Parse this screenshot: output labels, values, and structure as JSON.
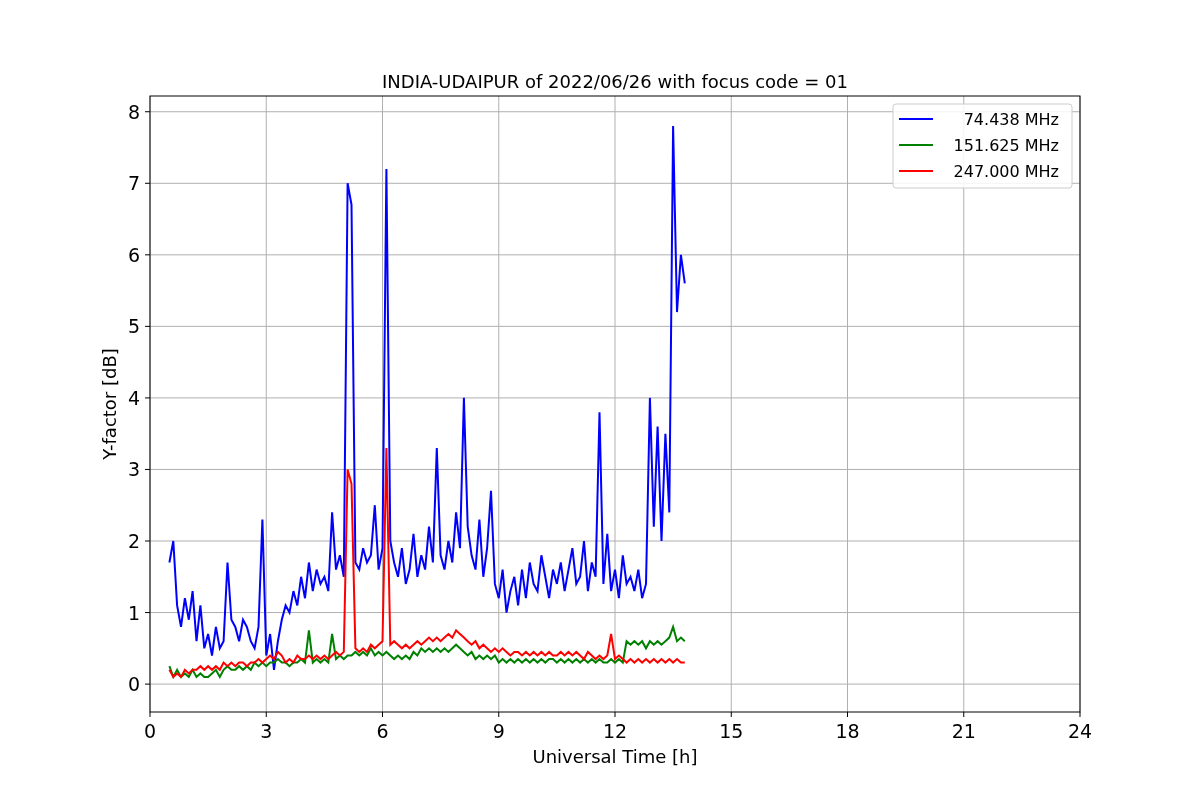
{
  "figure": {
    "chart_data": {
      "type": "line",
      "title": "INDIA-UDAIPUR of 2022/06/26 with focus code = 01",
      "xlabel": "Universal Time [h]",
      "ylabel": "Y-factor [dB]",
      "grid": true,
      "legend": true,
      "xlim": [
        0,
        24
      ],
      "ylim": [
        -0.39,
        8.22
      ],
      "xticks": [
        0,
        3,
        6,
        9,
        12,
        15,
        18,
        21,
        24
      ],
      "yticks": [
        0,
        1,
        2,
        3,
        4,
        5,
        6,
        7,
        8
      ],
      "x": [
        0.5,
        0.6,
        0.7,
        0.8,
        0.9,
        1.0,
        1.1,
        1.2,
        1.3,
        1.4,
        1.5,
        1.6,
        1.7,
        1.8,
        1.9,
        2.0,
        2.1,
        2.2,
        2.3,
        2.4,
        2.5,
        2.6,
        2.7,
        2.8,
        2.9,
        3.0,
        3.1,
        3.2,
        3.3,
        3.4,
        3.5,
        3.6,
        3.7,
        3.8,
        3.9,
        4.0,
        4.1,
        4.2,
        4.3,
        4.4,
        4.5,
        4.6,
        4.7,
        4.8,
        4.9,
        5.0,
        5.1,
        5.2,
        5.3,
        5.4,
        5.5,
        5.6,
        5.7,
        5.8,
        5.9,
        6.0,
        6.1,
        6.2,
        6.3,
        6.4,
        6.5,
        6.6,
        6.7,
        6.8,
        6.9,
        7.0,
        7.1,
        7.2,
        7.3,
        7.4,
        7.5,
        7.6,
        7.7,
        7.8,
        7.9,
        8.0,
        8.1,
        8.2,
        8.3,
        8.4,
        8.5,
        8.6,
        8.7,
        8.8,
        8.9,
        9.0,
        9.1,
        9.2,
        9.3,
        9.4,
        9.5,
        9.6,
        9.7,
        9.8,
        9.9,
        10.0,
        10.1,
        10.2,
        10.3,
        10.4,
        10.5,
        10.6,
        10.7,
        10.8,
        10.9,
        11.0,
        11.1,
        11.2,
        11.3,
        11.4,
        11.5,
        11.6,
        11.7,
        11.8,
        11.9,
        12.0,
        12.1,
        12.2,
        12.3,
        12.4,
        12.5,
        12.6,
        12.7,
        12.8,
        12.9,
        13.0,
        13.1,
        13.2,
        13.3,
        13.4,
        13.5,
        13.6,
        13.7,
        13.8
      ],
      "series": [
        {
          "name": "74.438 MHz",
          "color": "#0000ff",
          "values": [
            1.7,
            2.0,
            1.1,
            0.8,
            1.2,
            0.9,
            1.3,
            0.6,
            1.1,
            0.5,
            0.7,
            0.4,
            0.8,
            0.5,
            0.6,
            1.7,
            0.9,
            0.8,
            0.6,
            0.9,
            0.8,
            0.6,
            0.5,
            0.8,
            2.3,
            0.4,
            0.7,
            0.2,
            0.6,
            0.9,
            1.1,
            1.0,
            1.3,
            1.1,
            1.5,
            1.2,
            1.7,
            1.3,
            1.6,
            1.4,
            1.5,
            1.3,
            2.4,
            1.6,
            1.8,
            1.5,
            7.0,
            6.7,
            1.7,
            1.6,
            1.9,
            1.7,
            1.8,
            2.5,
            1.6,
            1.9,
            7.2,
            2.0,
            1.7,
            1.5,
            1.9,
            1.4,
            1.6,
            2.1,
            1.5,
            1.8,
            1.6,
            2.2,
            1.7,
            3.3,
            1.8,
            1.6,
            2.0,
            1.7,
            2.4,
            1.9,
            4.0,
            2.2,
            1.8,
            1.6,
            2.3,
            1.5,
            1.9,
            2.7,
            1.4,
            1.2,
            1.6,
            1.0,
            1.3,
            1.5,
            1.1,
            1.6,
            1.2,
            1.7,
            1.4,
            1.3,
            1.8,
            1.5,
            1.2,
            1.6,
            1.4,
            1.7,
            1.3,
            1.6,
            1.9,
            1.4,
            1.5,
            2.0,
            1.3,
            1.7,
            1.5,
            3.8,
            1.4,
            2.1,
            1.3,
            1.6,
            1.2,
            1.8,
            1.4,
            1.5,
            1.3,
            1.6,
            1.2,
            1.4,
            4.0,
            2.2,
            3.6,
            2.0,
            3.5,
            2.4,
            7.8,
            5.2,
            6.0,
            5.6
          ]
        },
        {
          "name": "151.625 MHz",
          "color": "#008000",
          "values": [
            0.25,
            0.1,
            0.2,
            0.1,
            0.15,
            0.1,
            0.2,
            0.1,
            0.15,
            0.1,
            0.1,
            0.15,
            0.2,
            0.1,
            0.2,
            0.25,
            0.2,
            0.2,
            0.25,
            0.2,
            0.25,
            0.2,
            0.3,
            0.25,
            0.3,
            0.25,
            0.3,
            0.3,
            0.35,
            0.3,
            0.3,
            0.25,
            0.3,
            0.3,
            0.35,
            0.3,
            0.75,
            0.3,
            0.35,
            0.3,
            0.35,
            0.3,
            0.7,
            0.35,
            0.4,
            0.35,
            0.4,
            0.4,
            0.45,
            0.4,
            0.45,
            0.4,
            0.5,
            0.4,
            0.45,
            0.4,
            0.45,
            0.4,
            0.35,
            0.4,
            0.35,
            0.4,
            0.35,
            0.45,
            0.4,
            0.5,
            0.45,
            0.5,
            0.45,
            0.5,
            0.45,
            0.5,
            0.45,
            0.5,
            0.55,
            0.5,
            0.45,
            0.4,
            0.45,
            0.35,
            0.4,
            0.35,
            0.4,
            0.35,
            0.4,
            0.3,
            0.35,
            0.3,
            0.35,
            0.3,
            0.35,
            0.3,
            0.35,
            0.3,
            0.35,
            0.3,
            0.35,
            0.3,
            0.35,
            0.35,
            0.3,
            0.35,
            0.3,
            0.35,
            0.3,
            0.35,
            0.3,
            0.35,
            0.3,
            0.35,
            0.3,
            0.35,
            0.3,
            0.3,
            0.35,
            0.3,
            0.35,
            0.3,
            0.6,
            0.55,
            0.6,
            0.55,
            0.6,
            0.5,
            0.6,
            0.55,
            0.6,
            0.55,
            0.6,
            0.65,
            0.8,
            0.6,
            0.65,
            0.6
          ]
        },
        {
          "name": "247.000 MHz",
          "color": "#ff0000",
          "values": [
            0.2,
            0.1,
            0.15,
            0.1,
            0.2,
            0.15,
            0.2,
            0.2,
            0.25,
            0.2,
            0.25,
            0.2,
            0.25,
            0.2,
            0.3,
            0.25,
            0.3,
            0.25,
            0.3,
            0.3,
            0.25,
            0.3,
            0.3,
            0.35,
            0.3,
            0.35,
            0.4,
            0.35,
            0.45,
            0.4,
            0.3,
            0.35,
            0.3,
            0.4,
            0.35,
            0.35,
            0.4,
            0.35,
            0.4,
            0.35,
            0.4,
            0.35,
            0.4,
            0.45,
            0.4,
            0.45,
            3.0,
            2.8,
            0.5,
            0.45,
            0.5,
            0.45,
            0.55,
            0.5,
            0.55,
            0.6,
            3.3,
            0.55,
            0.6,
            0.55,
            0.5,
            0.55,
            0.5,
            0.55,
            0.6,
            0.55,
            0.6,
            0.65,
            0.6,
            0.65,
            0.6,
            0.65,
            0.7,
            0.65,
            0.75,
            0.7,
            0.65,
            0.6,
            0.55,
            0.6,
            0.5,
            0.55,
            0.5,
            0.45,
            0.5,
            0.45,
            0.5,
            0.45,
            0.4,
            0.45,
            0.45,
            0.4,
            0.45,
            0.4,
            0.45,
            0.4,
            0.45,
            0.4,
            0.45,
            0.4,
            0.4,
            0.45,
            0.4,
            0.45,
            0.4,
            0.45,
            0.4,
            0.35,
            0.45,
            0.4,
            0.35,
            0.4,
            0.35,
            0.4,
            0.7,
            0.35,
            0.4,
            0.35,
            0.3,
            0.35,
            0.3,
            0.35,
            0.3,
            0.35,
            0.3,
            0.35,
            0.3,
            0.35,
            0.3,
            0.35,
            0.3,
            0.35,
            0.3,
            0.3
          ]
        }
      ]
    }
  }
}
